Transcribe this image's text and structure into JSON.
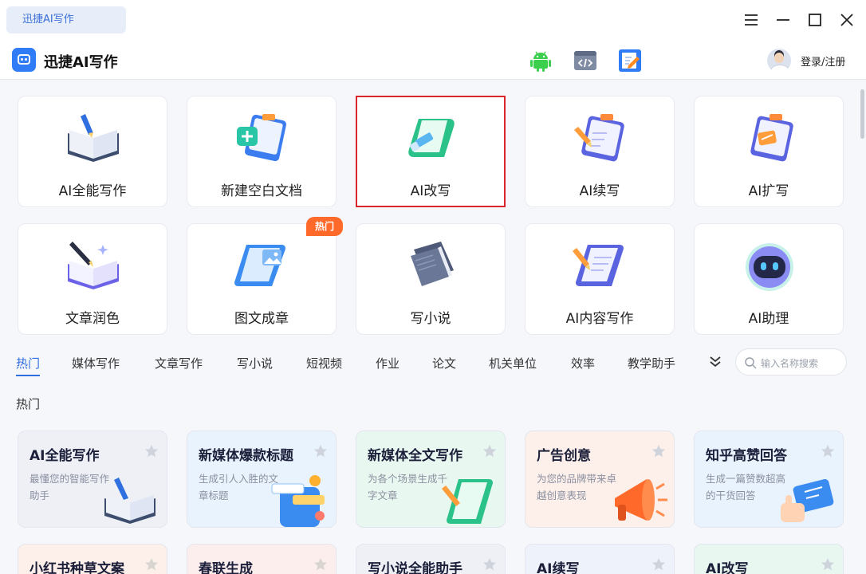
{
  "titlebar": {
    "tab_label": "迅捷AI写作"
  },
  "header": {
    "app_title": "迅捷AI写作",
    "login_label": "登录/注册"
  },
  "features": [
    {
      "label": "AI全能写作"
    },
    {
      "label": "新建空白文档"
    },
    {
      "label": "AI改写",
      "selected": true
    },
    {
      "label": "AI续写"
    },
    {
      "label": "AI扩写"
    },
    {
      "label": "文章润色"
    },
    {
      "label": "图文成章",
      "badge": "热门"
    },
    {
      "label": "写小说"
    },
    {
      "label": "AI内容写作"
    },
    {
      "label": "AI助理"
    }
  ],
  "hot_badge": "热门",
  "categories": [
    "热门",
    "媒体写作",
    "文章写作",
    "写小说",
    "短视频",
    "作业",
    "论文",
    "机关单位",
    "效率",
    "教学助手"
  ],
  "active_category": "热门",
  "search": {
    "placeholder": "输入名称搜索"
  },
  "section_title": "热门",
  "templates": [
    {
      "title": "AI全能写作",
      "desc": "最懂您的智能写作助手",
      "bg": "#eef0f6"
    },
    {
      "title": "新媒体爆款标题",
      "desc": "生成引人入胜的文章标题",
      "bg": "#e9f3fd"
    },
    {
      "title": "新媒体全文写作",
      "desc": "为各个场景生成千字文章",
      "bg": "#e8f7ef"
    },
    {
      "title": "广告创意",
      "desc": "为您的品牌带来卓越创意表现",
      "bg": "#fdf0ea"
    },
    {
      "title": "知乎高赞回答",
      "desc": "生成一篇赞数超高的干货回答",
      "bg": "#e9f3fd"
    },
    {
      "title": "小红书种草文案",
      "desc": "",
      "bg": "#fdf0ea"
    },
    {
      "title": "春联生成",
      "desc": "",
      "bg": "#fdeeee"
    },
    {
      "title": "写小说全能助手",
      "desc": "",
      "bg": "#eef0f6"
    },
    {
      "title": "AI续写",
      "desc": "",
      "bg": "#eef2fb"
    },
    {
      "title": "AI改写",
      "desc": "",
      "bg": "#e8f7ef"
    }
  ],
  "colors": {
    "accent": "#2f6fe0",
    "selection": "#d9262c",
    "hot": "#ff6a2b"
  }
}
